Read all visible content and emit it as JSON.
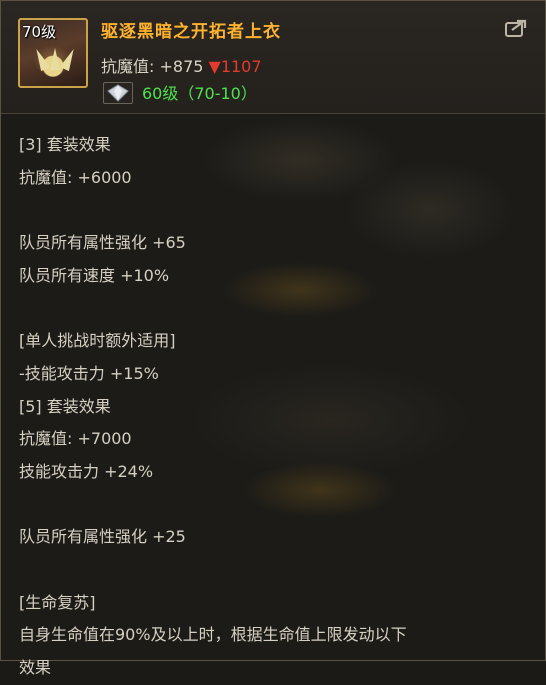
{
  "item": {
    "level_badge": "70级",
    "name": "驱逐黑暗之开拓者上衣",
    "stat_label": "抗魔值: +875 ",
    "stat_down": "▼1107",
    "level_range": "60级（70-10）"
  },
  "icons": [
    "share-icon",
    "gem-icon"
  ],
  "description": [
    "[3] 套装效果",
    "抗魔值: +6000",
    "",
    "队员所有属性强化 +65",
    "队员所有速度 +10%",
    "",
    "[单人挑战时额外适用]",
    "-技能攻击力 +15%",
    "[5] 套装效果",
    "抗魔值: +7000",
    "技能攻击力 +24%",
    "",
    "队员所有属性强化 +25",
    "",
    "[生命复苏]",
    "自身生命值在90%及以上时，根据生命值上限发动以下",
    "效果"
  ],
  "colors": {
    "item_name": "#ffb22e",
    "stat_down": "#e23a2e",
    "level_range": "#4ee24e",
    "icon_border": "#c9a24a",
    "body_text": "#d6d0c2"
  }
}
